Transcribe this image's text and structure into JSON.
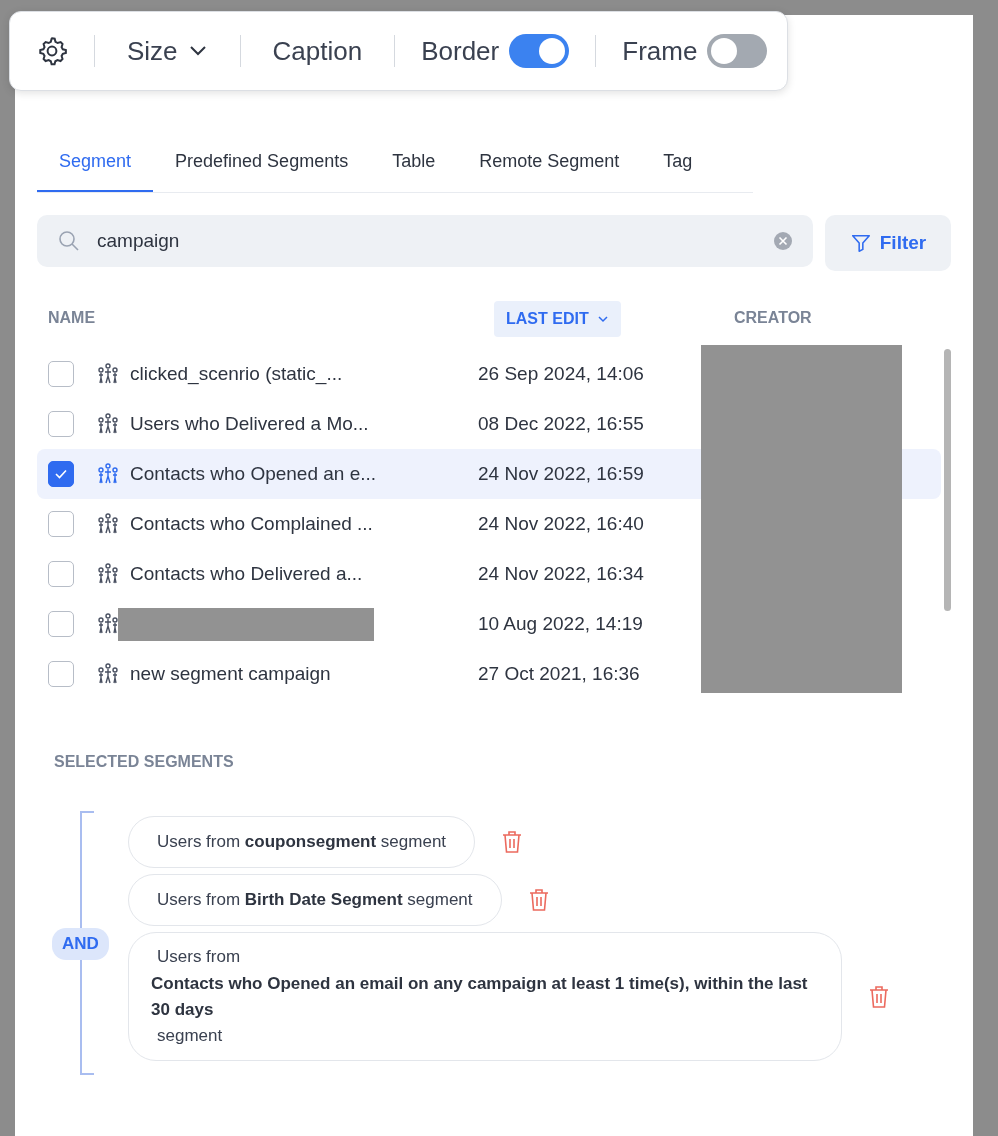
{
  "toolbar": {
    "size_label": "Size",
    "caption_label": "Caption",
    "border": {
      "label": "Border",
      "on": true
    },
    "frame": {
      "label": "Frame",
      "on": false
    }
  },
  "tabs": [
    {
      "label": "Segment",
      "selected": true
    },
    {
      "label": "Predefined Segments",
      "selected": false
    },
    {
      "label": "Table",
      "selected": false
    },
    {
      "label": "Remote Segment",
      "selected": false
    },
    {
      "label": "Tag",
      "selected": false
    }
  ],
  "search": {
    "value": "campaign"
  },
  "filter_button": "Filter",
  "table": {
    "columns": [
      {
        "label": "NAME",
        "sorted": false
      },
      {
        "label": "LAST EDIT",
        "sorted": true
      },
      {
        "label": "CREATOR",
        "sorted": false
      }
    ],
    "creator_redacted": true,
    "rows": [
      {
        "name": "clicked_scenrio (static_...",
        "last_edit": "26 Sep 2024, 14:06",
        "checked": false,
        "selected": false,
        "redacted": false
      },
      {
        "name": "Users who Delivered a Mo...",
        "last_edit": "08 Dec 2022, 16:55",
        "checked": false,
        "selected": false,
        "redacted": false
      },
      {
        "name": "Contacts who Opened an e...",
        "last_edit": "24 Nov 2022, 16:59",
        "checked": true,
        "selected": true,
        "redacted": false
      },
      {
        "name": "Contacts who Complained ...",
        "last_edit": "24 Nov 2022, 16:40",
        "checked": false,
        "selected": false,
        "redacted": false
      },
      {
        "name": "Contacts who Delivered a...",
        "last_edit": "24 Nov 2022, 16:34",
        "checked": false,
        "selected": false,
        "redacted": false
      },
      {
        "last_edit": "10 Aug 2022, 14:19",
        "checked": false,
        "selected": false,
        "redacted": true
      },
      {
        "name": "new segment campaign",
        "last_edit": "27 Oct 2021, 16:36",
        "checked": false,
        "selected": false,
        "redacted": false
      }
    ]
  },
  "selected_segments": {
    "title": "SELECTED SEGMENTS",
    "operator": "AND",
    "items": [
      {
        "kind": "inline",
        "text": "Users from  **couponsegment**  segment"
      },
      {
        "kind": "inline",
        "text": "Users from  **Birth Date Segment**  segment"
      },
      {
        "kind": "stacked",
        "prefix": "Users from",
        "name": "Contacts who Opened an email on any campaign at least 1 time(s), within the last 30 days",
        "suffix": "segment"
      }
    ]
  }
}
